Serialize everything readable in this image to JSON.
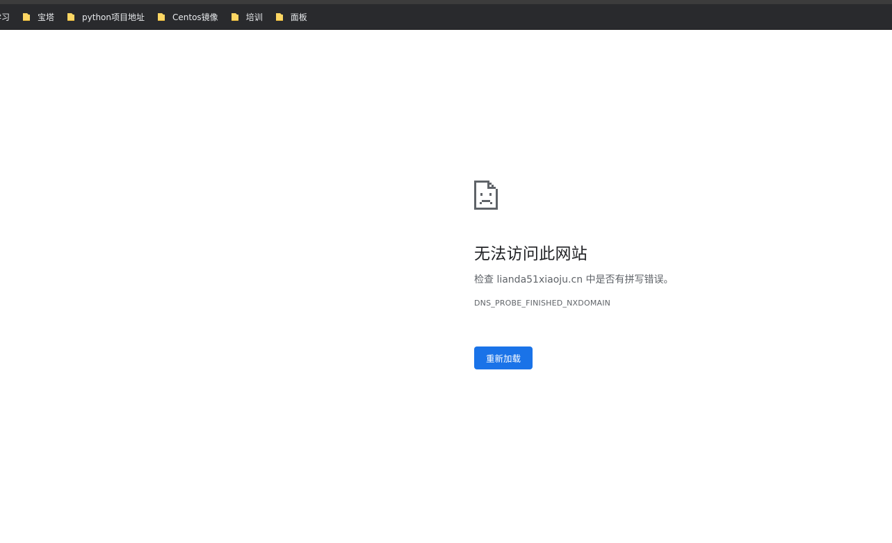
{
  "bookmarks": [
    {
      "label": "学习",
      "icon": "none",
      "partial": true
    },
    {
      "label": "宝塔",
      "icon": "folder-icon"
    },
    {
      "label": "python项目地址",
      "icon": "folder-icon"
    },
    {
      "label": "Centos镜像",
      "icon": "folder-icon"
    },
    {
      "label": "培训",
      "icon": "folder-icon"
    },
    {
      "label": "面板",
      "icon": "folder-icon"
    }
  ],
  "error_page": {
    "icon": "sad-page-icon",
    "title": "无法访问此网站",
    "suggestion_prefix": "检查 ",
    "domain": "lianda51xiaoju.cn",
    "suggestion_suffix": " 中是否有拼写错误。",
    "error_code": "DNS_PROBE_FINISHED_NXDOMAIN",
    "reload_label": "重新加载"
  },
  "colors": {
    "bookmarks_bar": "#292a2d",
    "folder": "#fcd663",
    "button": "#1a73e8",
    "title_text": "#202124",
    "secondary_text": "#5f6368"
  }
}
